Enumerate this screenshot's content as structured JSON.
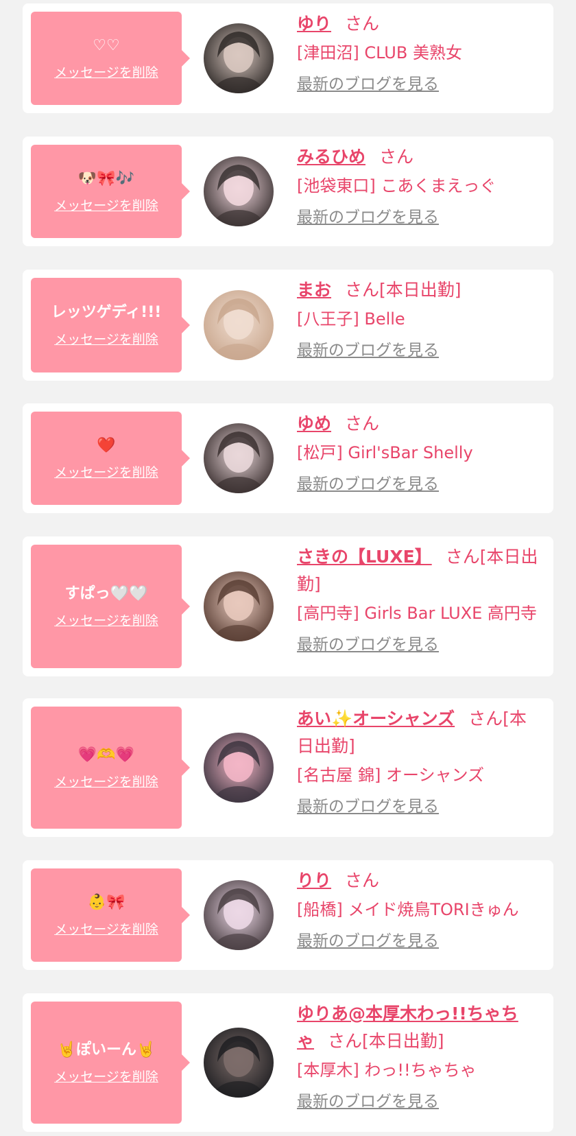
{
  "labels": {
    "delete": "メッセージを削除",
    "san": "さん",
    "blog": "最新のブログを見る"
  },
  "colors": {
    "accent": "#e8456a",
    "bubble": "#ff97a6",
    "link_gray": "#8a8a8a",
    "background": "#f2f2f2"
  },
  "entries": [
    {
      "message": "♡♡",
      "name": "ゆり",
      "status": "",
      "shop": "[津田沼] CLUB 美熟女",
      "avatar_icon": "profile-photo-icon",
      "avatar_colors": [
        "#2f2a28",
        "#d9c8c0"
      ]
    },
    {
      "message": "🐶🎀🎶",
      "name": "みるひめ",
      "status": "",
      "shop": "[池袋東口] こあくまえっぐ",
      "avatar_icon": "profile-photo-icon",
      "avatar_colors": [
        "#3a3232",
        "#f1d7dd"
      ]
    },
    {
      "message": "レッツゲディ!!!",
      "name": "まお",
      "status": "[本日出勤]",
      "shop": "[八王子] Belle",
      "avatar_icon": "profile-photo-icon",
      "avatar_colors": [
        "#c9a78e",
        "#f0ddd0"
      ]
    },
    {
      "message": "❤️",
      "name": "ゆめ",
      "status": "",
      "shop": "[松戸] Girl'sBar Shelly",
      "avatar_icon": "profile-photo-icon",
      "avatar_colors": [
        "#3b3030",
        "#e9d7d9"
      ]
    },
    {
      "message": "すぱっ🤍🤍",
      "name": "さきの【LUXE】",
      "status": "[本日出勤]",
      "shop": "[高円寺] Girls Bar LUXE 高円寺",
      "avatar_icon": "profile-photo-icon",
      "avatar_colors": [
        "#5a3f35",
        "#e8c9bd"
      ]
    },
    {
      "message": "💗🫶💗",
      "name": "あい✨オーシャンズ",
      "status": "[本日出勤]",
      "shop": "[名古屋 錦] オーシャンズ",
      "avatar_icon": "profile-photo-icon",
      "avatar_colors": [
        "#3d3540",
        "#f3b6c6"
      ]
    },
    {
      "message": "👶🎀",
      "name": "りり",
      "status": "",
      "shop": "[船橋] メイド焼鳥TORIきゅん",
      "avatar_icon": "profile-photo-icon",
      "avatar_colors": [
        "#4a3f43",
        "#ecd8e6"
      ]
    },
    {
      "message": "🤘ぽいーん🤘",
      "name": "ゆりあ@本厚木わっ!!ちゃちゃ",
      "status": "[本日出勤]",
      "shop": "[本厚木] わっ!!ちゃちゃ",
      "avatar_icon": "profile-photo-icon",
      "avatar_colors": [
        "#1f1f22",
        "#7d6d6a"
      ]
    }
  ]
}
